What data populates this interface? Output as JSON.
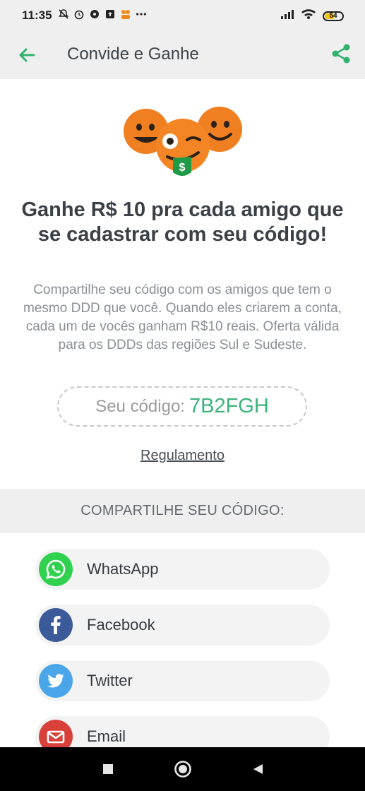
{
  "status_bar": {
    "time": "11:35",
    "battery_level": "54",
    "left_icons": [
      "mute-icon",
      "alarm-icon",
      "chat-icon",
      "upload-icon",
      "app-icon",
      "more-dots-icon"
    ],
    "right_icons": [
      "signal-icon",
      "wifi-icon",
      "battery-icon"
    ]
  },
  "app_bar": {
    "title": "Convide e Ganhe",
    "back_icon": "arrow-left-icon",
    "share_icon": "share-icon",
    "accent_color": "#2fb36f"
  },
  "hero": {
    "headline": "Ganhe R$ 10 pra cada amigo que se cadastrar com seu código!",
    "description": "Compartilhe seu código com os amigos que tem o mesmo DDD que você. Quando eles criarem a conta, cada um de vocês ganham R$10 reais. Oferta válida para os DDDs das regiões Sul e Sudeste.",
    "code_label": "Seu código:",
    "code_value": "7B2FGH",
    "rules_link": "Regulamento"
  },
  "share_section": {
    "header": "COMPARTILHE SEU CÓDIGO:",
    "options": [
      {
        "label": "WhatsApp",
        "icon": "whatsapp-icon",
        "color": "#2fd14f"
      },
      {
        "label": "Facebook",
        "icon": "facebook-icon",
        "color": "#3b5a9a"
      },
      {
        "label": "Twitter",
        "icon": "twitter-icon",
        "color": "#4aa6e8"
      },
      {
        "label": "Email",
        "icon": "email-icon",
        "color": "#d8413a"
      }
    ]
  },
  "nav_bar": {
    "buttons": [
      "recents-button",
      "home-button",
      "back-button"
    ]
  }
}
